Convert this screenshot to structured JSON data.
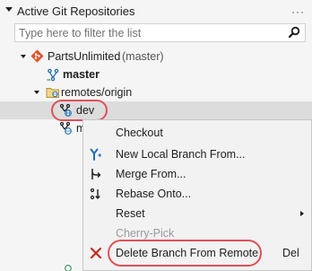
{
  "panel": {
    "title": "Active Git Repositories",
    "more_label": "···"
  },
  "filter": {
    "placeholder": "Type here to filter the list",
    "value": ""
  },
  "tree": {
    "repo_name": "PartsUnlimited",
    "repo_branch": "(master)",
    "master": "master",
    "remotes": "remotes/origin",
    "dev": "dev",
    "partial_next": "m"
  },
  "menu": {
    "items": [
      {
        "label": "Checkout"
      },
      {
        "label": "New Local Branch From..."
      },
      {
        "label": "Merge From..."
      },
      {
        "label": "Rebase Onto..."
      },
      {
        "label": "Reset"
      },
      {
        "label": "Cherry-Pick"
      },
      {
        "label": "Delete Branch From Remote",
        "shortcut": "Del"
      }
    ]
  },
  "colors": {
    "annotation": "#e0505a",
    "git_orange": "#e1522d",
    "branch_blue": "#1f6fb5",
    "delete_red": "#c42b1c"
  }
}
